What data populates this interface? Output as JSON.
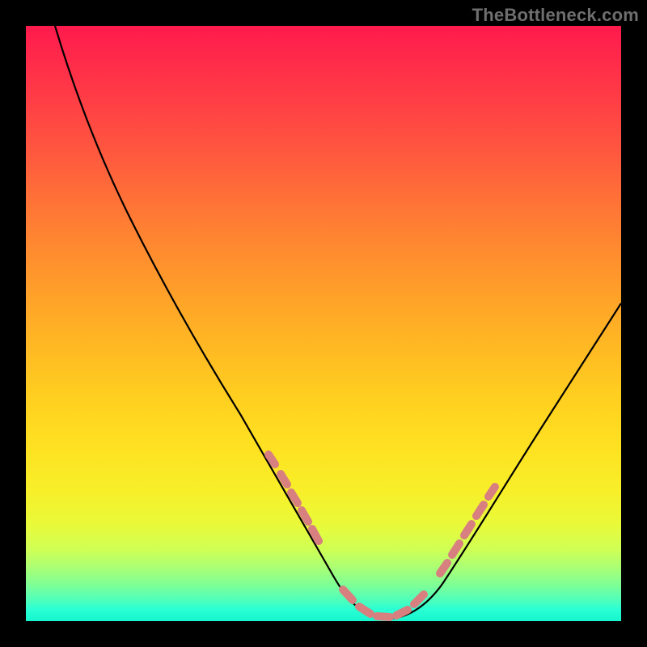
{
  "watermark": {
    "text": "TheBottleneck.com"
  },
  "chart_data": {
    "type": "line",
    "title": "",
    "xlabel": "",
    "ylabel": "",
    "xlim": [
      0,
      100
    ],
    "ylim": [
      0,
      100
    ],
    "series": [
      {
        "name": "curve",
        "x": [
          5,
          10,
          15,
          20,
          25,
          30,
          35,
          40,
          45,
          50,
          53,
          56,
          60,
          63,
          66,
          70,
          75,
          80,
          85,
          90,
          95,
          100
        ],
        "y": [
          100,
          92,
          83,
          73,
          63,
          53,
          43,
          33,
          23,
          12,
          6,
          2,
          0,
          0,
          2,
          7,
          14,
          22,
          30,
          38,
          46,
          54
        ]
      }
    ],
    "markers": [
      {
        "name": "dotted-highlight",
        "segments": [
          {
            "x": [
              40.5,
              49.0
            ],
            "y": [
              32.0,
              14.0
            ]
          },
          {
            "x": [
              53.5,
              66.0
            ],
            "y": [
              4.0,
              2.0
            ]
          },
          {
            "x": [
              68.0,
              77.0
            ],
            "y": [
              5.0,
              17.0
            ]
          }
        ]
      }
    ]
  }
}
